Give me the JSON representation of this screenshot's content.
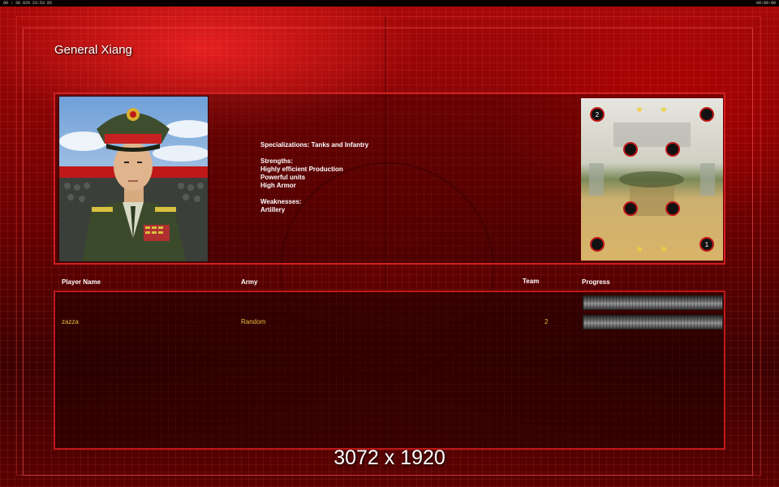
{
  "system_bar": {
    "left_text": "00 : 38 02% 23:53 85",
    "right_text": "00:00:00"
  },
  "general": {
    "title": "General Xiang",
    "portrait_icon": "general-portrait"
  },
  "description": {
    "specialization": "Specializations: Tanks and Infantry",
    "strengths_heading": "Strengths:",
    "strengths": [
      "Highly efficient Production",
      "Powerful units",
      "High Armor"
    ],
    "weaknesses_heading": "Weaknesses:",
    "weaknesses": [
      "Artillery"
    ]
  },
  "minimap": {
    "start_labels": [
      "2",
      "1"
    ]
  },
  "players_table": {
    "headers": {
      "player_name": "Player Name",
      "army": "Army",
      "team": "Team",
      "progress": "Progress"
    },
    "rows": [
      {
        "player_name": "",
        "army": "",
        "team": "",
        "progress": 0.0
      },
      {
        "player_name": "zazza",
        "army": "Random",
        "team": "2",
        "progress": 0.0
      }
    ]
  },
  "overlay": {
    "resolution": "3072 x 1920"
  },
  "colors": {
    "accent": "#d02020",
    "player_text": "#e8c040"
  }
}
